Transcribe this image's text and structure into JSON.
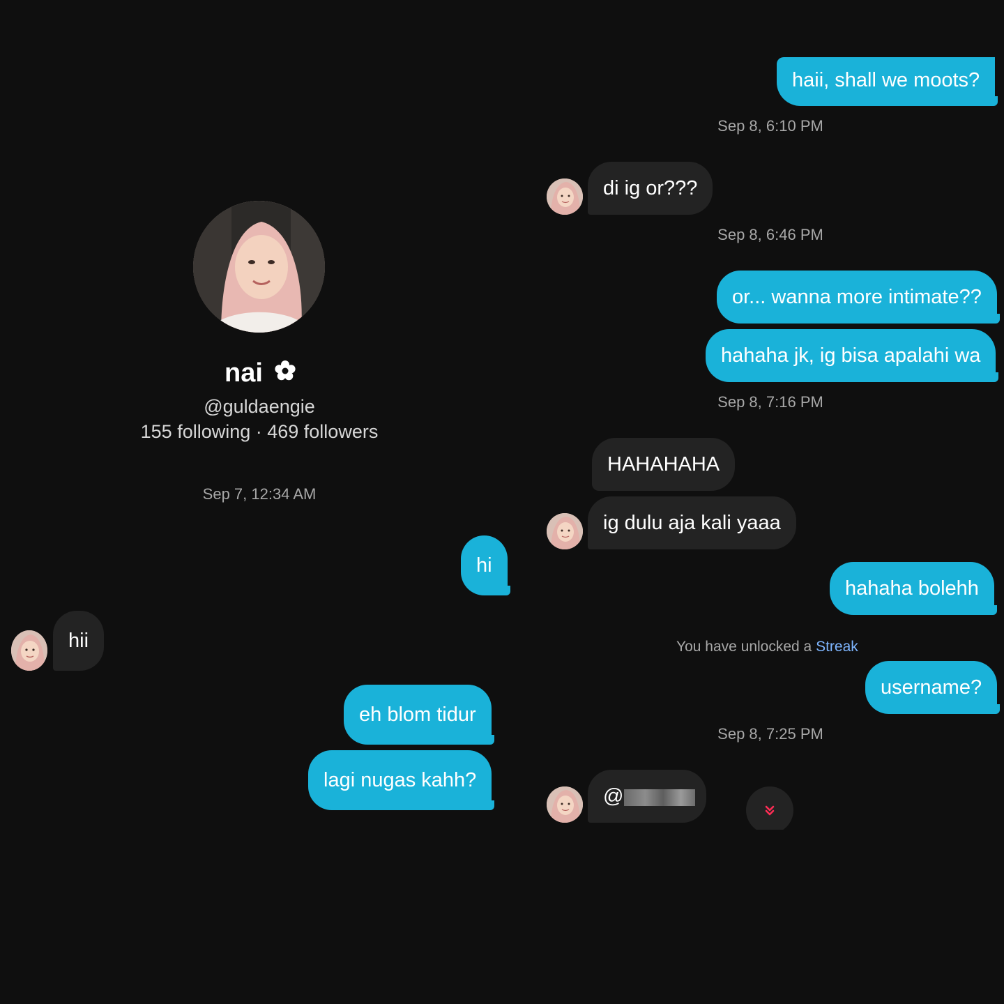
{
  "profile": {
    "name": "nai",
    "name_icon": "flower-icon",
    "handle": "@guldaengie",
    "stats": "155 following · 469 followers"
  },
  "left_chat": {
    "timestamp": "Sep 7, 12:34 AM",
    "messages": [
      {
        "from": "me",
        "text": "hi"
      },
      {
        "from": "them",
        "text": "hii"
      },
      {
        "from": "me",
        "text": "eh blom tidur"
      },
      {
        "from": "me",
        "text": "lagi nugas kahh?"
      }
    ]
  },
  "right_chat": {
    "messages": [
      {
        "from": "me",
        "text": "haii, shall we moots?"
      },
      {
        "type": "timestamp",
        "text": "Sep 8, 6:10 PM"
      },
      {
        "from": "them",
        "text": "di ig or???"
      },
      {
        "type": "timestamp",
        "text": "Sep 8, 6:46 PM"
      },
      {
        "from": "me",
        "text": "or... wanna more intimate??"
      },
      {
        "from": "me",
        "text": "hahaha jk, ig bisa apalahi wa"
      },
      {
        "type": "timestamp",
        "text": "Sep 8, 7:16 PM"
      },
      {
        "from": "them",
        "text": "HAHAHAHA"
      },
      {
        "from": "them",
        "text": "ig dulu aja kali yaaa"
      },
      {
        "from": "me",
        "text": "hahaha bolehh"
      },
      {
        "type": "system",
        "text": "You have unlocked a ",
        "link": "Streak"
      },
      {
        "from": "me",
        "text": "username?"
      },
      {
        "type": "timestamp",
        "text": "Sep 8, 7:25 PM"
      },
      {
        "from": "them",
        "text": "@r"
      }
    ]
  },
  "colors": {
    "background": "#0f0f0f",
    "my_bubble": "#1ab2d9",
    "their_bubble": "#232323",
    "link": "#7fb6ff",
    "scroll_arrow": "#ff2d55"
  },
  "icons": {
    "scroll_down": "chevrons-down-icon"
  }
}
